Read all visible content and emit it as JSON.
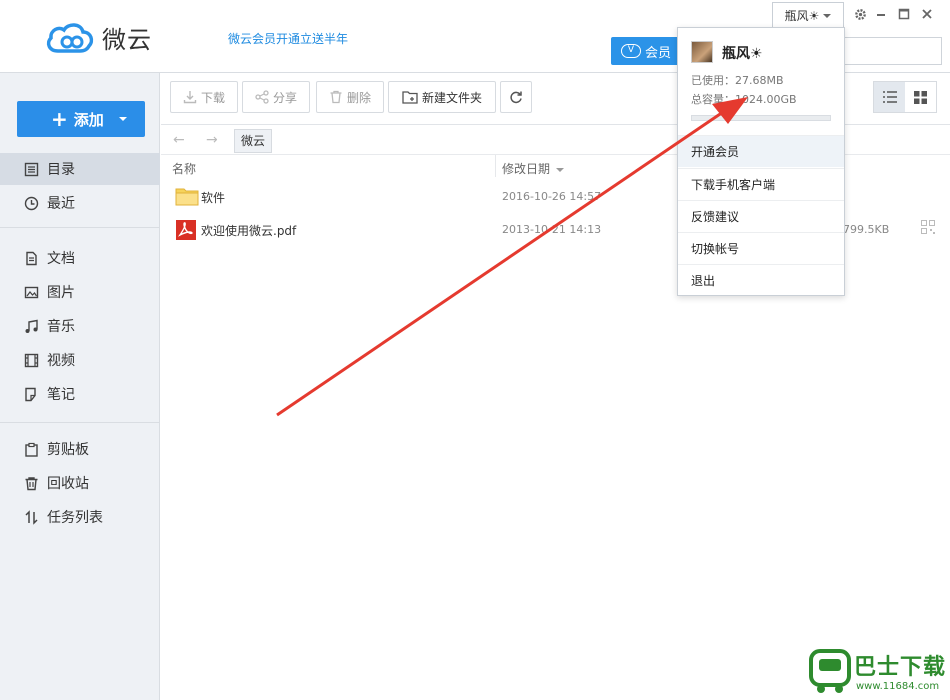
{
  "app": {
    "name": "微云",
    "promo": "微云会员开通立送半年",
    "vip_button": "会员",
    "user_tab": "瓶风☀"
  },
  "sidebar": {
    "add_button": "添加",
    "items": [
      {
        "label": "目录",
        "icon": "directory-icon",
        "active": true
      },
      {
        "label": "最近",
        "icon": "clock-icon"
      },
      {
        "label": "文档",
        "icon": "document-icon"
      },
      {
        "label": "图片",
        "icon": "image-icon"
      },
      {
        "label": "音乐",
        "icon": "music-icon"
      },
      {
        "label": "视频",
        "icon": "video-icon"
      },
      {
        "label": "笔记",
        "icon": "note-icon"
      },
      {
        "label": "剪贴板",
        "icon": "clipboard-icon"
      },
      {
        "label": "回收站",
        "icon": "trash-icon"
      },
      {
        "label": "任务列表",
        "icon": "transfer-icon"
      }
    ]
  },
  "toolbar": {
    "download": "下载",
    "share": "分享",
    "delete": "删除",
    "new_folder": "新建文件夹"
  },
  "breadcrumb": {
    "current": "微云"
  },
  "file_list": {
    "columns": {
      "name": "名称",
      "date": "修改日期"
    },
    "rows": [
      {
        "name": "软件",
        "type": "folder",
        "date": "2016-10-26 14:57",
        "size": ""
      },
      {
        "name": "欢迎使用微云.pdf",
        "type": "pdf",
        "date": "2013-10-21 14:13",
        "size": "799.5KB"
      }
    ]
  },
  "user_menu": {
    "username": "瓶风☀",
    "used": "已使用：27.68MB",
    "total": "总容量：1024.00GB",
    "usage_fraction": 2.6e-05,
    "items": [
      "开通会员",
      "下载手机客户端",
      "反馈建议",
      "切换帐号",
      "退出"
    ]
  },
  "watermark": {
    "title": "巴士下载",
    "url": "www.11684.com"
  },
  "colors": {
    "accent": "#2b8ee8",
    "annotation": "#e53a2f",
    "watermark": "#2e8b2e"
  }
}
